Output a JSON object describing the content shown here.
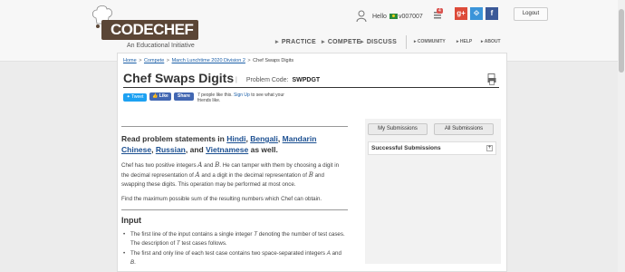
{
  "header": {
    "logo_text": "CODECHEF",
    "tagline": "An Educational Initiative",
    "greeting": "Hello",
    "username": "v007007",
    "notification_count": "4",
    "logout_label": "Logout",
    "nav": {
      "practice": "PRACTICE",
      "compete": "COMPETE",
      "discuss": "DISCUSS"
    },
    "subnav": {
      "community": "COMMUNITY",
      "help": "HELP",
      "about": "ABOUT"
    },
    "social": {
      "gplus": "g+",
      "github": "⟐",
      "facebook": "f"
    }
  },
  "breadcrumb": {
    "home": "Home",
    "compete": "Compete",
    "contest": "March Lunchtime 2020 Division 2",
    "current": "Chef Swaps Digits"
  },
  "problem": {
    "title": "Chef Swaps Digits",
    "code_label": "Problem Code:",
    "code": "SWPDGT"
  },
  "share": {
    "tweet": "Tweet",
    "like": "Like",
    "share": "Share",
    "likes_pre": "7 people like this.",
    "signup": "Sign Up",
    "likes_post": "to see what your friends like."
  },
  "statement": {
    "read_pre": "Read problem statements in",
    "hindi": "Hindi",
    "bengali": "Bengali",
    "mandarin": "Mandarin Chinese",
    "russian": "Russian",
    "and": "and",
    "vietnamese": "Vietnamese",
    "as_well": "as well.",
    "p1_a": "Chef has two positive integers",
    "var_a": "A",
    "p1_and": "and",
    "var_b": "B",
    "p1_b": ". He can tamper with them by choosing a digit in the decimal representation of",
    "p1_c": "and a digit in the decimal representation of",
    "p1_d": "and swapping these digits. This operation may be performed at most once.",
    "p2": "Find the maximum possible sum of the resulting numbers which Chef can obtain.",
    "input_heading": "Input",
    "b1_a": "The first line of the input contains a single integer",
    "var_t": "T",
    "b1_b": "denoting the number of test cases. The description of",
    "b1_c": "test cases follows.",
    "b2_a": "The first and only line of each test case contains two space-separated integers",
    "b2_and": "and",
    "b2_end": "."
  },
  "sidebar": {
    "my_submissions": "My Submissions",
    "all_submissions": "All Submissions",
    "successful": "Successful Submissions",
    "expand": "+"
  }
}
